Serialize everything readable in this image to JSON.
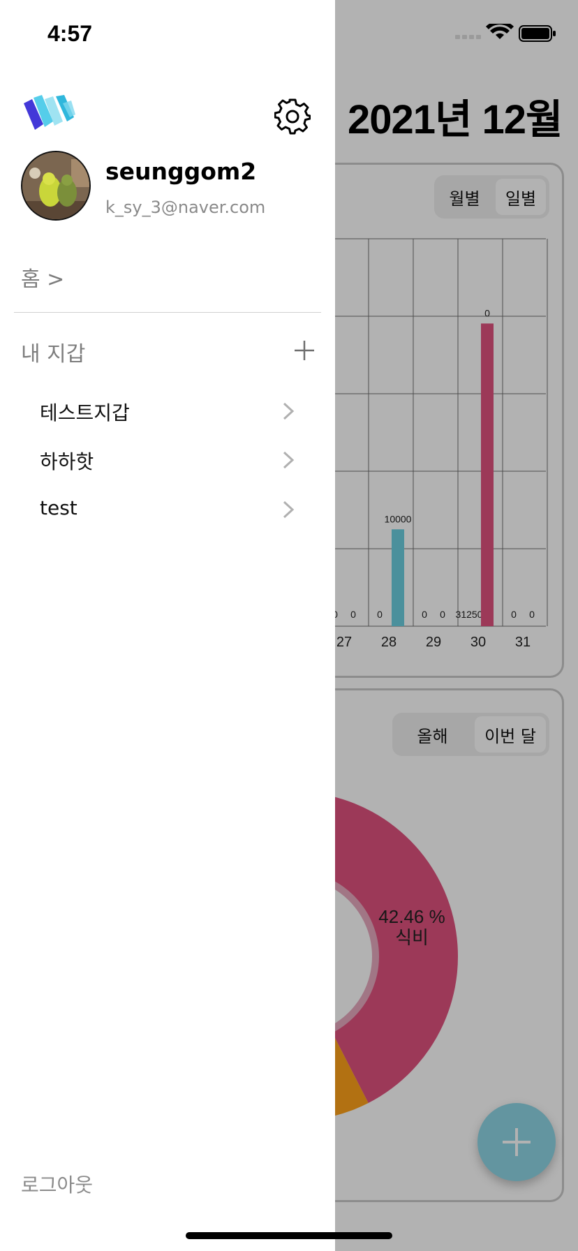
{
  "status_bar": {
    "time": "4:57"
  },
  "drawer": {
    "profile": {
      "username": "seunggom2",
      "email": "k_sy_3@naver.com"
    },
    "home_link": "홈 >",
    "wallet_header": "내 지갑",
    "wallets": [
      {
        "label": "테스트지갑"
      },
      {
        "label": "하하핫"
      },
      {
        "label": "test"
      }
    ],
    "logout": "로그아웃"
  },
  "background": {
    "title": "2021년 12월",
    "bar_segment": {
      "options": [
        "월별",
        "일별"
      ],
      "selected": "일별"
    },
    "pie_segment": {
      "options": [
        "올해",
        "이번 달"
      ],
      "selected": "이번 달"
    },
    "fab_icon": "plus-icon",
    "colors": {
      "expense": "#e0527f",
      "income": "#6ccfe0",
      "food": "#e0527f",
      "other": "#ffa31a",
      "fab": "#8ed6e6"
    }
  },
  "chart_data": [
    {
      "type": "bar",
      "categories": [
        "27",
        "28",
        "29",
        "30",
        "31"
      ],
      "series": [
        {
          "values": [
            0,
            0,
            0,
            0,
            0
          ],
          "color": "#6ccfe0"
        },
        {
          "values": [
            0,
            10000,
            0,
            31250,
            0
          ],
          "color_by_point": [
            "#6ccfe0",
            "#6ccfe0",
            "#e0527f",
            "#e0527f",
            "#e0527f"
          ]
        }
      ],
      "value_labels": [
        [
          "0",
          "0"
        ],
        [
          "0",
          "10000"
        ],
        [
          "0",
          "0"
        ],
        [
          "31250",
          "0"
        ],
        [
          "0",
          "0"
        ]
      ],
      "grid": true
    },
    {
      "type": "pie",
      "slices": [
        {
          "label": "식비",
          "percent_label": "42.46 %",
          "value": 42.46,
          "color": "#e0527f"
        },
        {
          "label": "",
          "value": 57.54,
          "color": "#ffa31a"
        }
      ]
    }
  ]
}
